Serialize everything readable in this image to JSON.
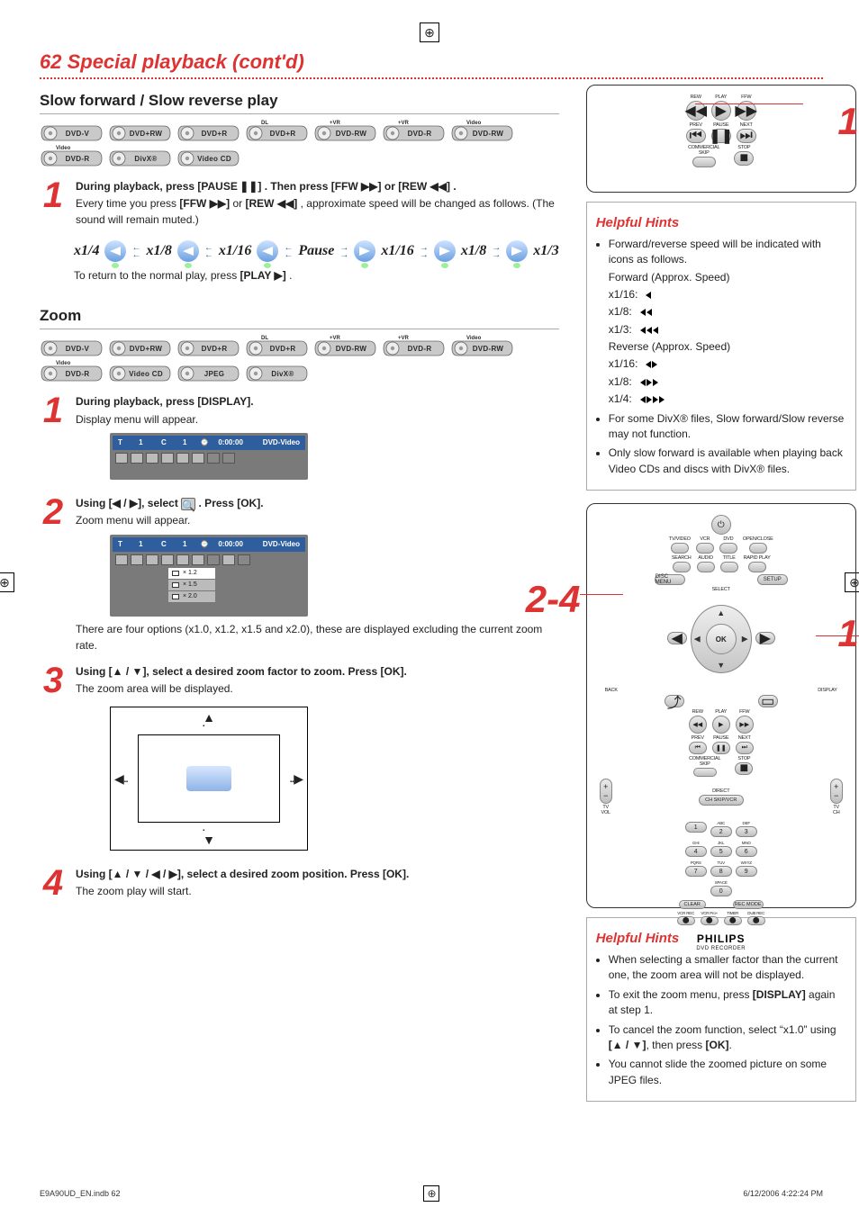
{
  "page_title": "62 Special playback (cont'd)",
  "section_slow": {
    "heading": "Slow forward / Slow reverse play",
    "discs": [
      "DVD-V",
      "DVD+RW",
      "DVD+R",
      "DVD+R DL",
      "DVD-RW +VR",
      "DVD-R +VR",
      "DVD-RW Video",
      "DVD-R Video",
      "DivX®",
      "Video CD"
    ],
    "step1": {
      "num": "1",
      "line_a_pre": "During playback, press ",
      "btn_pause": "[PAUSE ❚❚]",
      "line_a_mid": ". Then press ",
      "btn_ffw": "[FFW ▶▶]",
      "line_a_or": " or ",
      "btn_rew": "[REW ◀◀]",
      "line_a_end": ".",
      "line_b_pre": "Every time you press ",
      "line_b_or": " or ",
      "line_b_end": ", approximate speed will be changed as follows. (The sound will remain muted.)"
    },
    "speeds_rev": [
      "x1/4",
      "x1/8",
      "x1/16"
    ],
    "pause_label": "Pause",
    "speeds_fwd": [
      "x1/16",
      "x1/8",
      "x1/3"
    ],
    "return_pre": "To return to the normal play, press ",
    "return_btn": "[PLAY ▶]",
    "return_end": "."
  },
  "section_zoom": {
    "heading": "Zoom",
    "discs": [
      "DVD-V",
      "DVD+RW",
      "DVD+R",
      "DVD+R DL",
      "DVD-RW +VR",
      "DVD-R +VR",
      "DVD-RW Video",
      "DVD-R Video",
      "Video CD",
      "JPEG",
      "DivX®"
    ],
    "s1": {
      "num": "1",
      "a": "During playback, press ",
      "b": "[DISPLAY]",
      "c": ".",
      "d": "Display menu will appear."
    },
    "s2": {
      "num": "2",
      "a": "Using [",
      "b": "◀ / ▶",
      "c": "], select ",
      "d": " . Press ",
      "e": "[OK]",
      "f": ".",
      "g": "Zoom menu will appear."
    },
    "s3": {
      "num": "3",
      "a": "Using [",
      "b": "▲ / ▼",
      "c": "], select a desired zoom factor to zoom. Press ",
      "d": "[OK]",
      "e": ".",
      "f": "The zoom area will be displayed."
    },
    "s4": {
      "num": "4",
      "a": "Using [",
      "b": "▲ / ▼ / ◀ / ▶",
      "c": "], select a desired zoom position. Press ",
      "d": "[OK]",
      "e": ".",
      "f": "The zoom play will start."
    },
    "options_note": "There are four options (x1.0, x1.2, x1.5 and x2.0), these are displayed excluding the current zoom rate.",
    "panel": {
      "head_left_t": "T",
      "head_left_tval": "1",
      "head_left_c": "C",
      "head_left_cval": "1",
      "head_time": "0:00:00",
      "head_right": "DVD-Video",
      "opts": [
        "× 1.2",
        "× 1.5",
        "× 2.0"
      ]
    }
  },
  "remote_top": {
    "callout": "1",
    "rew": "REW",
    "play": "PLAY",
    "ffw": "FFW",
    "prev": "PREV",
    "pause": "PAUSE",
    "next": "NEXT",
    "commercial": "COMMERCIAL",
    "skip": "SKIP",
    "stop": "STOP"
  },
  "hints_top": {
    "title": "Helpful Hints",
    "b1": "Forward/reverse speed will be indicated with icons as follows.",
    "fwd_lbl": "Forward (Approx. Speed)",
    "fwd": [
      "x1/16:",
      "x1/8:",
      "x1/3:"
    ],
    "rev_lbl": "Reverse (Approx. Speed)",
    "rev": [
      "x1/16:",
      "x1/8:",
      "x1/4:"
    ],
    "b2": "For some DivX® files, Slow forward/Slow reverse may not function.",
    "b3": "Only slow forward is available when playing back Video CDs and discs with DivX® files."
  },
  "remote_main": {
    "callout_24": "2-4",
    "callout_1": "1",
    "row1": [
      "TV/VIDEO",
      "VCR",
      "DVD",
      "OPEN/CLOSE"
    ],
    "row2": [
      "SEARCH",
      "AUDIO",
      "TITLE",
      "RAPID PLAY"
    ],
    "discmenu": "DISC MENU",
    "select_lbl": "SELECT",
    "setup": "SETUP",
    "ok": "OK",
    "back": "BACK",
    "display": "DISPLAY",
    "trans": [
      "REW",
      "PLAY",
      "FFW",
      "PREV",
      "PAUSE",
      "NEXT"
    ],
    "commercial": "COMMERCIAL",
    "skip": "SKIP",
    "stop": "STOP",
    "tvvol": "TV\nVOL",
    "direct": "DIRECT",
    "ch_skip": "CH SKIP/VCR",
    "tvch": "TV\nCH",
    "def": "DEF",
    "abc": "ABC",
    "ghi": "GHI",
    "jkl": "JKL",
    "mno": "MNO",
    "pqrs": "PQRS",
    "tuv": "TUV",
    "wxyz": "WXYZ",
    "space": "SPACE",
    "clear": "CLEAR",
    "rec": "REC MODE",
    "bot": [
      "VCR REC",
      "VCR Pro+",
      "TIMER",
      "DUB REC"
    ],
    "brand": "PHILIPS",
    "sub": "DVD RECORDER"
  },
  "hints_bottom": {
    "title": "Helpful Hints",
    "b1": "When selecting a smaller factor than the current one, the zoom area will not be displayed.",
    "b2_a": "To exit the zoom menu, press ",
    "b2_b": "[DISPLAY]",
    "b2_c": " again at step 1.",
    "b3_a": "To cancel the zoom function, select “x1.0” using ",
    "b3_b": "[▲ / ▼]",
    "b3_c": ", then press ",
    "b3_d": "[OK]",
    "b3_e": ".",
    "b4": "You cannot slide the zoomed picture on some JPEG files."
  },
  "footer": {
    "left": "E9A90UD_EN.indb   62",
    "right": "6/12/2006   4:22:24 PM"
  }
}
